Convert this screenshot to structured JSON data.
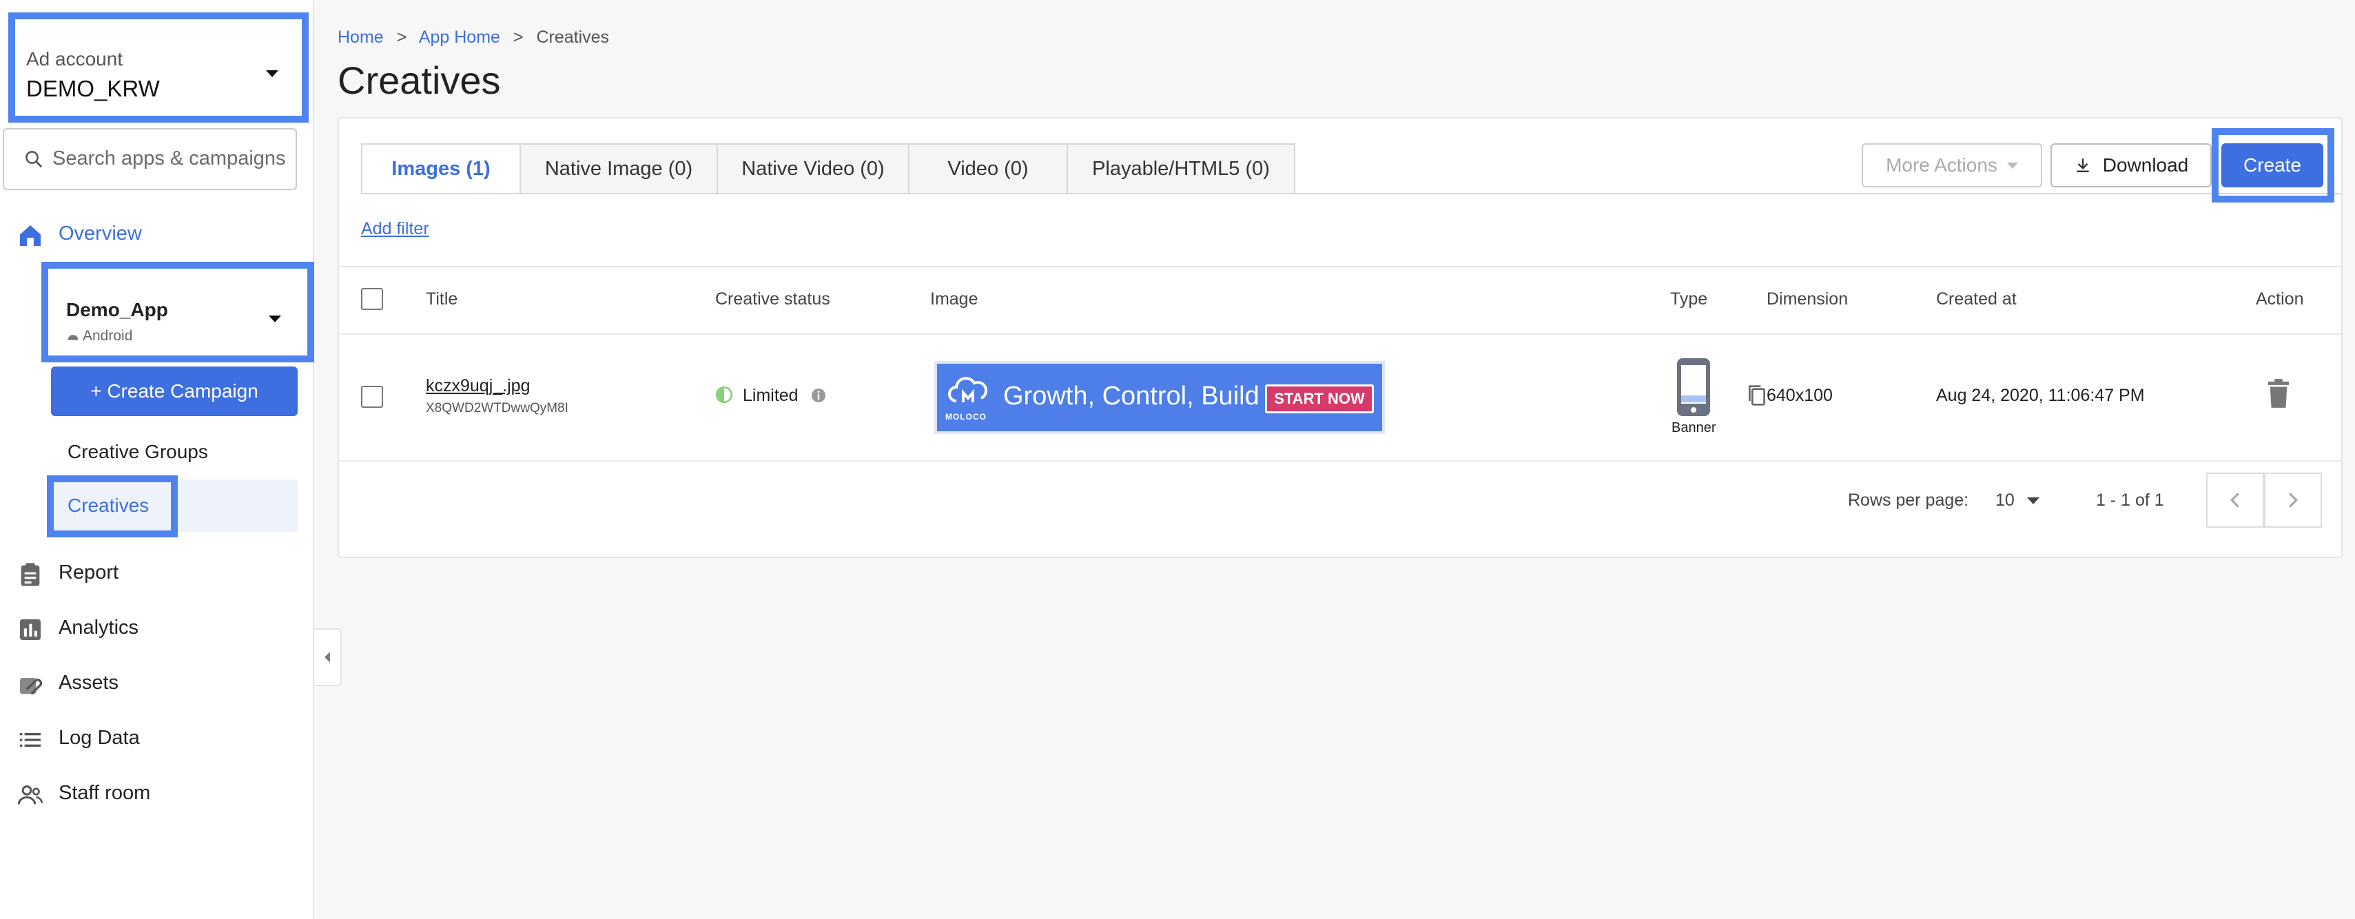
{
  "sidebar": {
    "account_label": "Ad account",
    "account_value": "DEMO_KRW",
    "search_placeholder": "Search apps & campaigns",
    "overview_label": "Overview",
    "app_name": "Demo_App",
    "app_platform": "Android",
    "create_campaign_label": "+ Create Campaign",
    "creative_groups_label": "Creative Groups",
    "creatives_label": "Creatives",
    "nav": [
      {
        "label": "Report",
        "icon": "clipboard-icon"
      },
      {
        "label": "Analytics",
        "icon": "bar-chart-icon"
      },
      {
        "label": "Assets",
        "icon": "paperclip-icon"
      },
      {
        "label": "Log Data",
        "icon": "list-icon"
      },
      {
        "label": "Staff room",
        "icon": "people-icon"
      }
    ]
  },
  "breadcrumb": {
    "home": "Home",
    "app_home": "App Home",
    "current": "Creatives",
    "separator": ">"
  },
  "page_title": "Creatives",
  "tabs": [
    {
      "label": "Images (1)",
      "active": true
    },
    {
      "label": "Native Image (0)"
    },
    {
      "label": "Native Video (0)"
    },
    {
      "label": "Video (0)"
    },
    {
      "label": "Playable/HTML5 (0)"
    }
  ],
  "toolbar": {
    "more_actions_label": "More Actions",
    "download_label": "Download",
    "create_label": "Create"
  },
  "add_filter_label": "Add filter",
  "table": {
    "columns": {
      "title": "Title",
      "status": "Creative status",
      "image": "Image",
      "type": "Type",
      "dimension": "Dimension",
      "created_at": "Created at",
      "action": "Action"
    },
    "rows": [
      {
        "title": "kczx9uqj_.jpg",
        "id": "X8QWD2WTDwwQyM8I",
        "status": "Limited",
        "banner_text": "Growth, Control, Build",
        "banner_cta": "START NOW",
        "banner_brand": "MOLOCO",
        "type": "Banner",
        "dimension": "640x100",
        "created_at": "Aug 24, 2020, 11:06:47 PM"
      }
    ]
  },
  "pagination": {
    "rows_per_page_label": "Rows per page:",
    "rows_per_page_value": "10",
    "range": "1 - 1 of 1"
  },
  "colors": {
    "accent": "#3d6fe0",
    "highlight": "#4f84f0",
    "status_limited": "#8bd17c",
    "cta": "#d63a6a"
  }
}
